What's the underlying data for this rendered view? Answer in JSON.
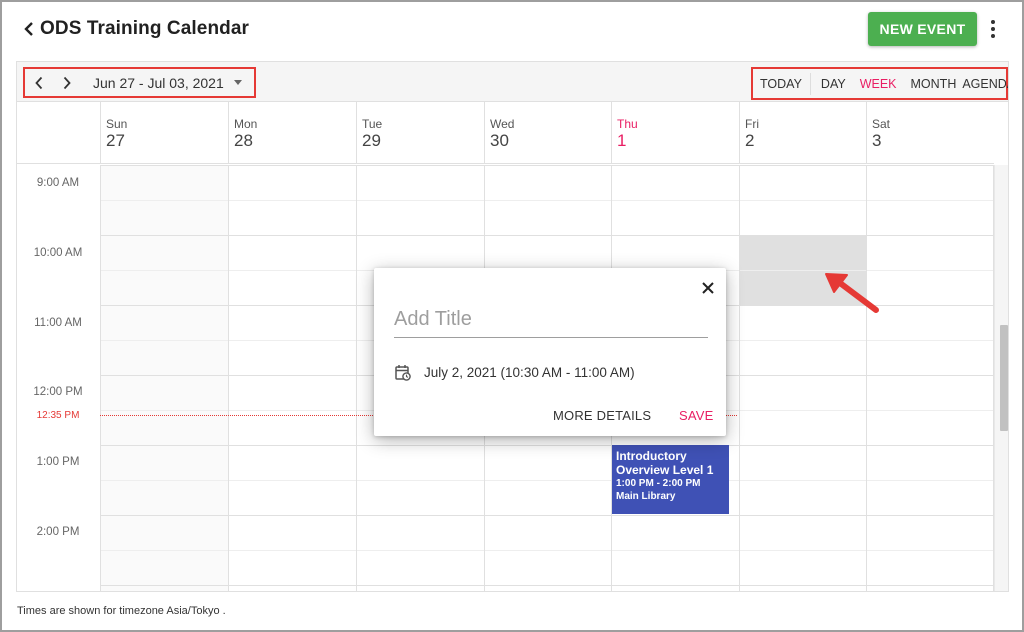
{
  "app": {
    "title": "ODS Training Calendar",
    "new_event_label": "NEW EVENT"
  },
  "toolbar": {
    "date_range": "Jun 27 - Jul 03, 2021",
    "views": {
      "today": "TODAY",
      "day": "DAY",
      "week": "WEEK",
      "month": "MONTH",
      "agenda": "AGENDA"
    },
    "active_view": "week"
  },
  "days": [
    {
      "name": "Sun",
      "num": "27"
    },
    {
      "name": "Mon",
      "num": "28"
    },
    {
      "name": "Tue",
      "num": "29"
    },
    {
      "name": "Wed",
      "num": "30"
    },
    {
      "name": "Thu",
      "num": "1"
    },
    {
      "name": "Fri",
      "num": "2"
    },
    {
      "name": "Sat",
      "num": "3"
    }
  ],
  "times": [
    "9:00 AM",
    "10:00 AM",
    "11:00 AM",
    "12:00 PM",
    "1:00 PM",
    "2:00 PM"
  ],
  "now_label": "12:35 PM",
  "event": {
    "title": "Introductory Overview Level 1",
    "time": "1:00 PM - 2:00 PM",
    "location": "Main Library",
    "color": "#3f51b5"
  },
  "popup": {
    "title_placeholder": "Add Title",
    "date_text": "July 2, 2021 (10:30 AM - 11:00 AM)",
    "more_details_label": "MORE DETAILS",
    "save_label": "SAVE"
  },
  "footer": {
    "timezone_note": "Times are shown for timezone Asia/Tokyo ."
  },
  "colors": {
    "accent": "#e91e63",
    "primary_button": "#4caf50",
    "annotation": "#e53935",
    "event": "#3f51b5"
  }
}
